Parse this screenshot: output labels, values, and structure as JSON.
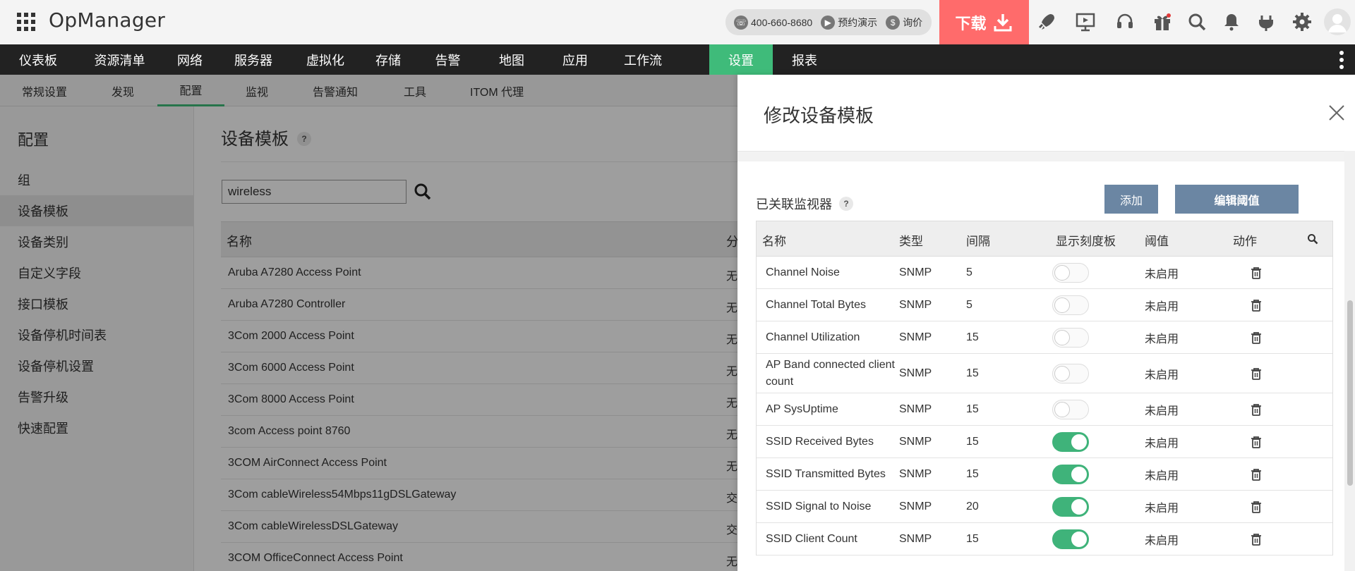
{
  "header": {
    "app_title": "OpManager",
    "phone": "400-660-8680",
    "demo": "预约演示",
    "quote": "询价",
    "download_label": "下载"
  },
  "mainnav": {
    "items": [
      {
        "label": "仪表板",
        "active": false
      },
      {
        "label": "资源清单",
        "active": false
      },
      {
        "label": "网络",
        "active": false
      },
      {
        "label": "服务器",
        "active": false
      },
      {
        "label": "虚拟化",
        "active": false
      },
      {
        "label": "存储",
        "active": false
      },
      {
        "label": "告警",
        "active": false
      },
      {
        "label": "地图",
        "active": false
      },
      {
        "label": "应用",
        "active": false
      },
      {
        "label": "工作流",
        "active": false
      },
      {
        "label": "设置",
        "active": true
      },
      {
        "label": "报表",
        "active": false
      }
    ]
  },
  "subnav": {
    "items": [
      "常规设置",
      "发现",
      "配置",
      "监视",
      "告警通知",
      "工具",
      "ITOM 代理"
    ],
    "active_index": 2
  },
  "sidebar": {
    "title": "配置",
    "items": [
      "组",
      "设备模板",
      "设备类别",
      "自定义字段",
      "接口模板",
      "设备停机时间表",
      "设备停机设置",
      "告警升级",
      "快速配置"
    ],
    "active_index": 1
  },
  "main": {
    "title": "设备模板",
    "help": "?",
    "search_value": "wireless",
    "table": {
      "col_name": "名称",
      "col_category": "分",
      "rows": [
        {
          "name": "Aruba A7280 Access Point",
          "cat": "无"
        },
        {
          "name": "Aruba A7280 Controller",
          "cat": "无"
        },
        {
          "name": "3Com 2000 Access Point",
          "cat": "无"
        },
        {
          "name": "3Com 6000 Access Point",
          "cat": "无"
        },
        {
          "name": "3Com 8000 Access Point",
          "cat": "无"
        },
        {
          "name": "3com Access point 8760",
          "cat": "无"
        },
        {
          "name": "3COM AirConnect Access Point",
          "cat": "无"
        },
        {
          "name": "3Com cableWireless54Mbps11gDSLGateway",
          "cat": "交"
        },
        {
          "name": "3Com cableWirelessDSLGateway",
          "cat": "交"
        },
        {
          "name": "3COM OfficeConnect Access Point",
          "cat": "无"
        }
      ]
    }
  },
  "panel": {
    "title": "修改设备模板",
    "section_label": "已关联监视器",
    "help": "?",
    "add_label": "添加",
    "edit_label": "编辑阈值",
    "columns": [
      "名称",
      "类型",
      "间隔",
      "显示刻度板",
      "阈值",
      "动作"
    ],
    "rows": [
      {
        "name": "Channel Noise",
        "type": "SNMP",
        "interval": "5",
        "dial": false,
        "threshold": "未启用"
      },
      {
        "name": "Channel Total Bytes",
        "type": "SNMP",
        "interval": "5",
        "dial": false,
        "threshold": "未启用"
      },
      {
        "name": "Channel Utilization",
        "type": "SNMP",
        "interval": "15",
        "dial": false,
        "threshold": "未启用"
      },
      {
        "name": "AP Band connected client count",
        "type": "SNMP",
        "interval": "15",
        "dial": false,
        "threshold": "未启用"
      },
      {
        "name": "AP SysUptime",
        "type": "SNMP",
        "interval": "15",
        "dial": false,
        "threshold": "未启用"
      },
      {
        "name": "SSID Received Bytes",
        "type": "SNMP",
        "interval": "15",
        "dial": true,
        "threshold": "未启用"
      },
      {
        "name": "SSID Transmitted Bytes",
        "type": "SNMP",
        "interval": "15",
        "dial": true,
        "threshold": "未启用"
      },
      {
        "name": "SSID Signal to Noise",
        "type": "SNMP",
        "interval": "20",
        "dial": true,
        "threshold": "未启用"
      },
      {
        "name": "SSID Client Count",
        "type": "SNMP",
        "interval": "15",
        "dial": true,
        "threshold": "未启用"
      }
    ]
  },
  "colors": {
    "accent_green": "#3fbb7a",
    "download_red": "#ff6b6b",
    "button_blue": "#6b86a3",
    "nav_dark": "#222222"
  }
}
